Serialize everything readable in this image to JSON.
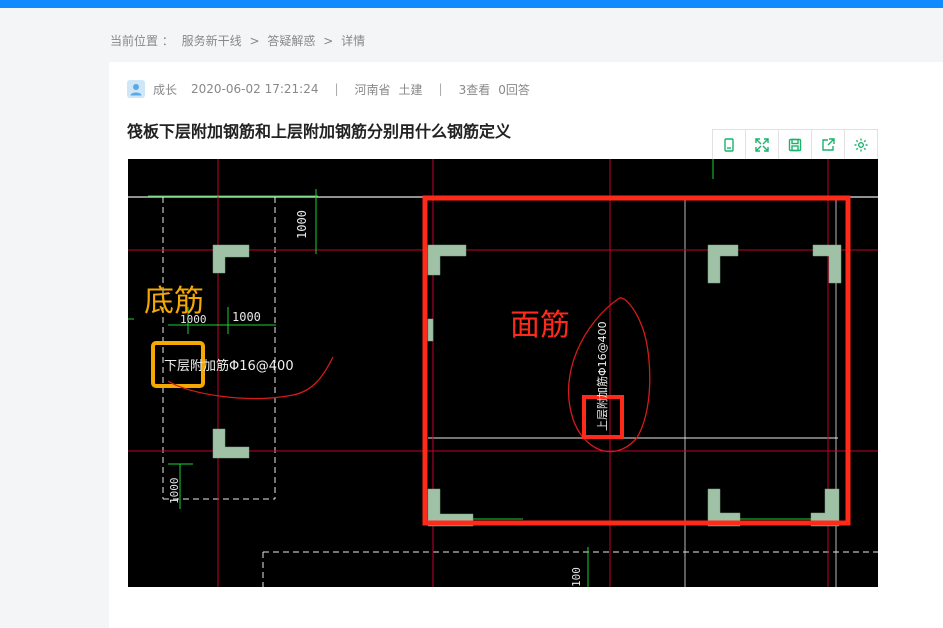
{
  "breadcrumb": {
    "label": "当前位置 ：",
    "items": [
      "服务新干线",
      "答疑解惑",
      "详情"
    ],
    "separator": ">"
  },
  "post": {
    "author": "成长",
    "datetime": "2020-06-02 17:21:24",
    "province": "河南省",
    "category": "土建",
    "views": "3查看",
    "answers": "0回答",
    "title": "筏板下层附加钢筋和上层附加钢筋分别用什么钢筋定义"
  },
  "toolbar": {
    "icons": [
      "fit-page-icon",
      "fullscreen-icon",
      "save-icon",
      "share-icon",
      "settings-icon"
    ],
    "color": "#19b36b"
  },
  "drawing": {
    "annotation_bottom": "底筋",
    "annotation_top": "面筋",
    "label_bottom_rebar": "下层附加筋Φ16@400",
    "label_top_rebar": "上层附加筋Φ16@400",
    "dim_1000": "1000",
    "colors": {
      "background": "#000000",
      "annotation_bottom": "#f5a800",
      "annotation_top": "#ff2a1a",
      "axis": "#c4002a",
      "dimension": "#19d238",
      "column": "#9fc2a6"
    }
  }
}
